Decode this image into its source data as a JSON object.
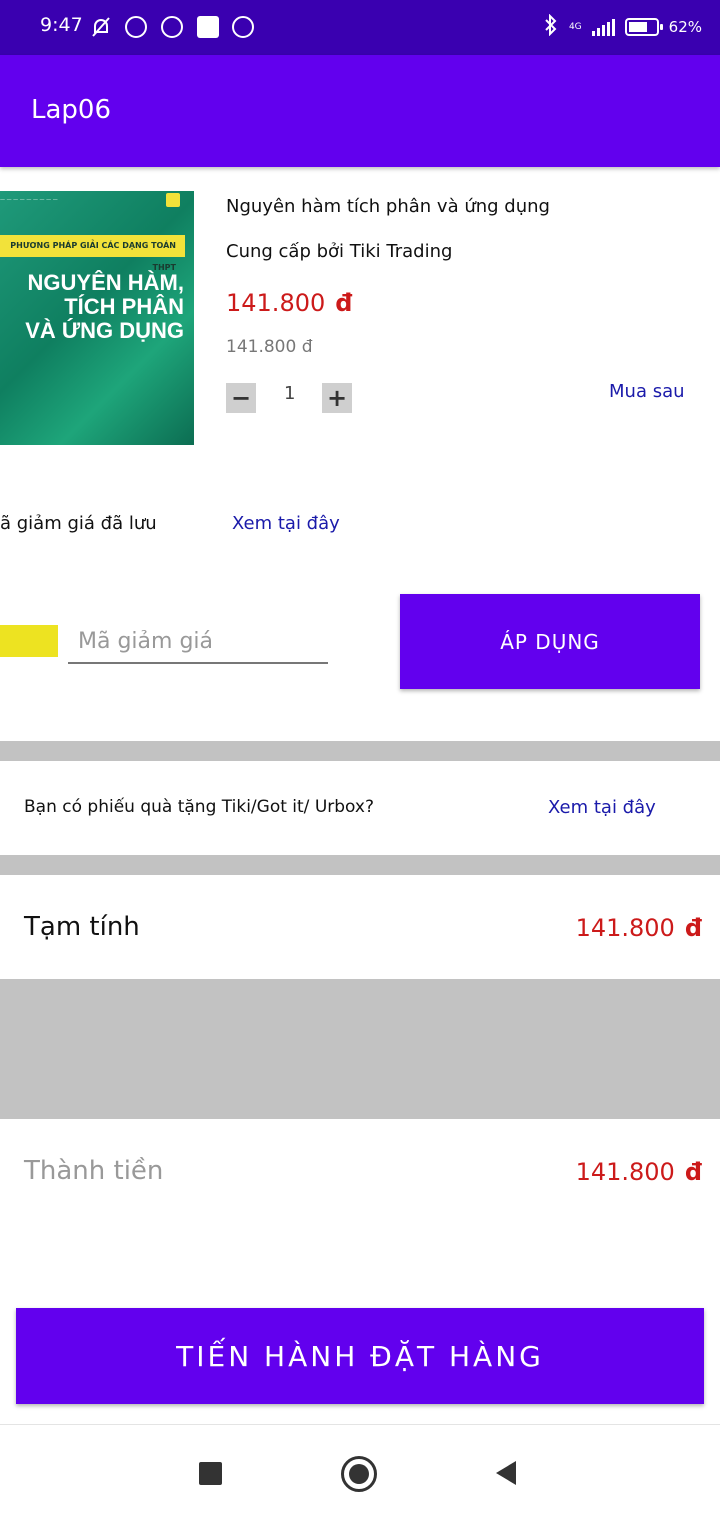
{
  "status_bar": {
    "time": "9:47",
    "network": "4G",
    "battery": "62%"
  },
  "app_bar": {
    "title": "Lap06"
  },
  "product": {
    "cover_text": [
      "PHƯƠNG PHÁP GIẢI CÁC DẠNG TOÁN THPT",
      "NGUYÊN HÀM,",
      "TÍCH PHÂN",
      "VÀ ỨNG DỤNG"
    ],
    "title": "Nguyên hàm tích phân và ứng dụng",
    "seller": "Cung cấp bởi Tiki Trading",
    "price": "141.800",
    "currency": "đ",
    "original_price": "141.800  đ",
    "quantity": "1",
    "minus_label": "−",
    "plus_label": "+",
    "buy_later": "Mua sau"
  },
  "voucher": {
    "saved_label": "ã giảm giá đã lưu",
    "saved_link": "Xem tại đây",
    "code_placeholder": "Mã giảm giá",
    "apply_label": "ÁP DỤNG"
  },
  "gift": {
    "question": "Bạn có phiếu quà tặng Tiki/Got it/ Urbox?",
    "link": "Xem tại đây"
  },
  "summary": {
    "subtotal_label": "Tạm tính",
    "subtotal_value": "141.800",
    "total_label": "Thành tiền",
    "total_value": "141.800",
    "currency": "đ"
  },
  "checkout_label": "TIẾN HÀNH ĐẶT HÀNG",
  "colors": {
    "primary": "#6200ee",
    "status_bar": "#3a00b0",
    "price_red": "#cc1a1a",
    "link_blue": "#1a1aaa",
    "divider_gray": "#c2c2c2",
    "accent_yellow": "#ede321"
  }
}
